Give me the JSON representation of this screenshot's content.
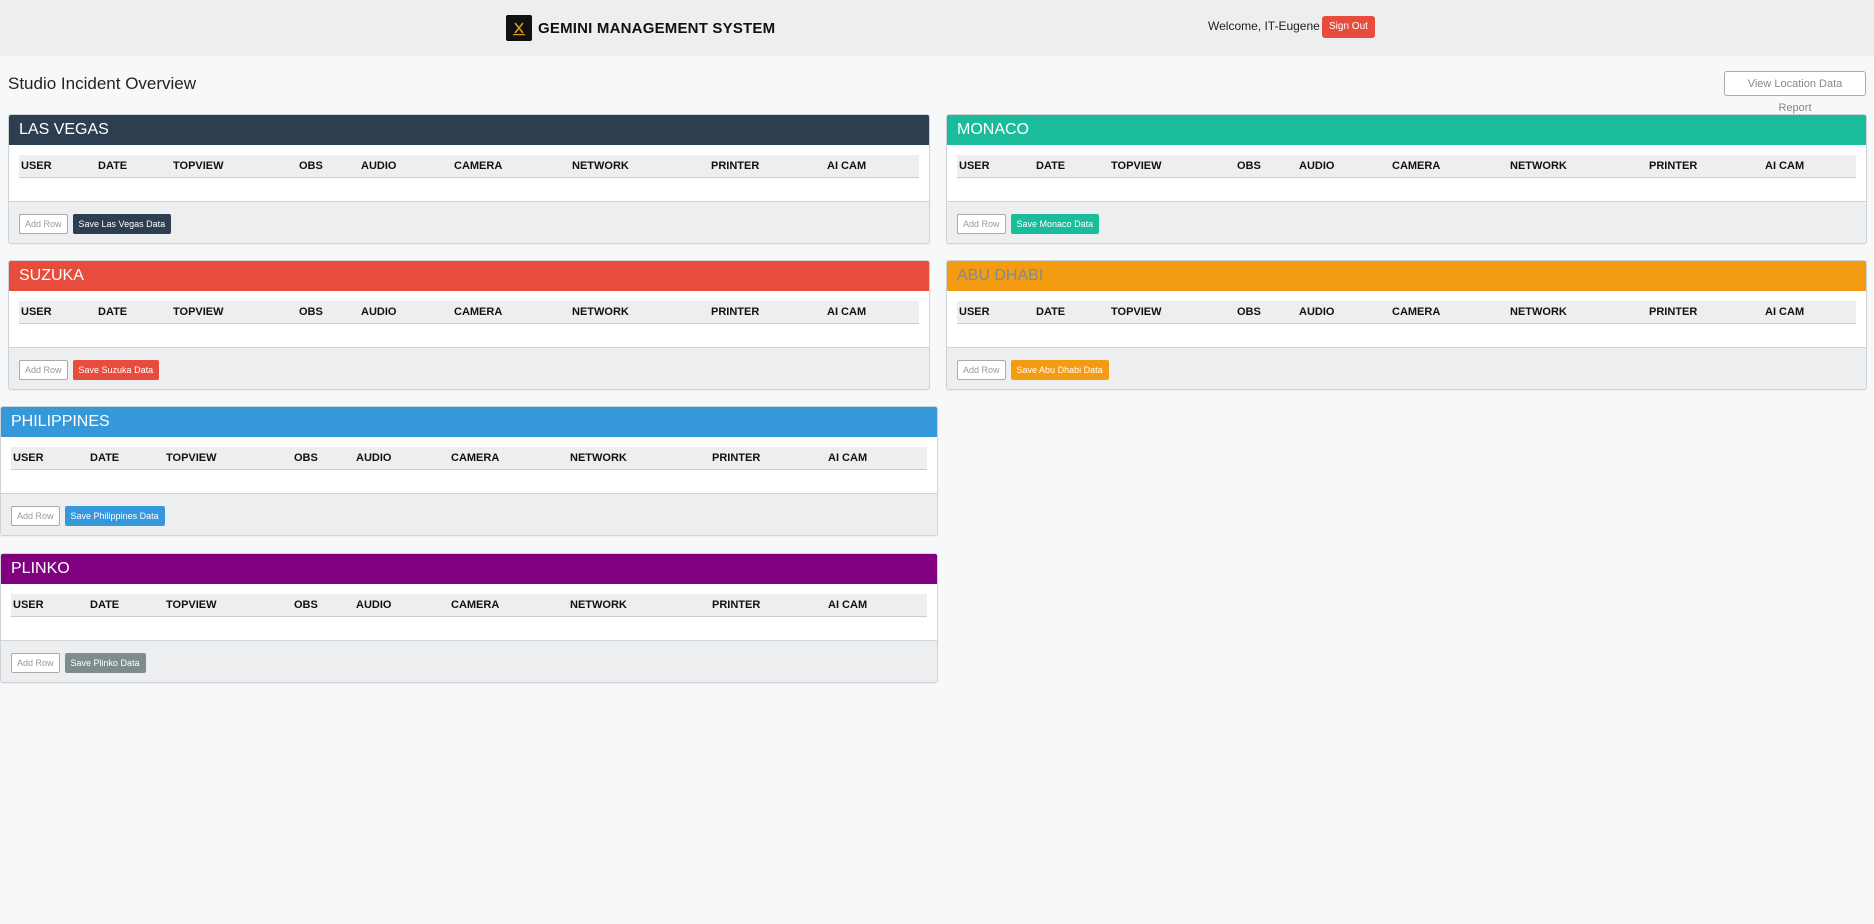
{
  "header": {
    "brand_title": "GEMINI MANAGEMENT SYSTEM",
    "welcome_text": "Welcome, IT-Eugene",
    "signout_label": "Sign Out",
    "logo_icon": "gemini-logo-icon"
  },
  "page": {
    "title": "Studio Incident Overview",
    "report_button_label": "View Location Data Report"
  },
  "table_columns": [
    "USER",
    "DATE",
    "TOPVIEW",
    "OBS",
    "AUDIO",
    "CAMERA",
    "NETWORK",
    "PRINTER",
    "AI CAM"
  ],
  "panels": [
    {
      "name": "LAS VEGAS",
      "color": "#2c3e50",
      "title_color": "#ffffff",
      "add_row_label": "Add Row",
      "save_label": "Save Las Vegas Data"
    },
    {
      "name": "MONACO",
      "color": "#1abc9c",
      "title_color": "#ffffff",
      "add_row_label": "Add Row",
      "save_label": "Save Monaco Data"
    },
    {
      "name": "SUZUKA",
      "color": "#e74c3c",
      "title_color": "#ffffff",
      "add_row_label": "Add Row",
      "save_label": "Save Suzuka Data"
    },
    {
      "name": "ABU DHABI",
      "color": "#f39c12",
      "title_color": "#7f8c8d",
      "add_row_label": "Add Row",
      "save_label": "Save Abu Dhabi Data"
    },
    {
      "name": "PHILIPPINES",
      "color": "#3498db",
      "title_color": "#ffffff",
      "add_row_label": "Add Row",
      "save_label": "Save Philippines Data"
    },
    {
      "name": "PLINKO",
      "color": "#800080",
      "title_color": "#ffffff",
      "add_row_label": "Add Row",
      "save_label": "Save Plinko Data",
      "save_color": "#7f8c8d"
    }
  ]
}
